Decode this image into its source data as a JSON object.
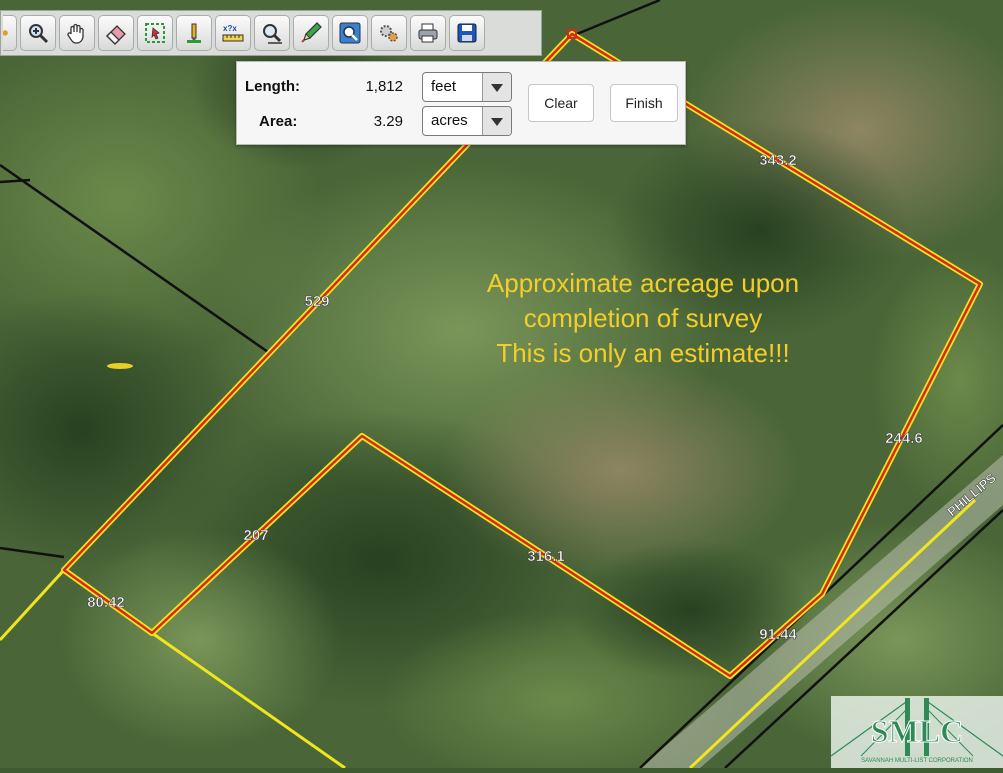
{
  "toolbar": {
    "tools": [
      {
        "icon": "partial-tool-icon"
      },
      {
        "icon": "zoom-in-icon"
      },
      {
        "icon": "pan-hand-icon"
      },
      {
        "icon": "eraser-icon"
      },
      {
        "icon": "select-region-icon"
      },
      {
        "icon": "marker-icon"
      },
      {
        "icon": "measure-icon"
      },
      {
        "icon": "zoom-extent-icon"
      },
      {
        "icon": "pencil-icon"
      },
      {
        "icon": "zoom-full-icon"
      },
      {
        "icon": "layers-gears-icon"
      },
      {
        "icon": "print-icon"
      },
      {
        "icon": "save-icon"
      }
    ]
  },
  "measure": {
    "length_label": "Length:",
    "length_value": "1,812",
    "length_unit": "feet",
    "area_label": "Area:",
    "area_value": "3.29",
    "area_unit": "acres",
    "clear_label": "Clear",
    "finish_label": "Finish"
  },
  "parcel": {
    "segment_labels": [
      "343.2",
      "529",
      "244.6",
      "207",
      "316.1",
      "80.42",
      "91.44"
    ],
    "road_label": "PHILLIPS",
    "annotation_lines": [
      "Approximate acreage upon",
      "completion of survey",
      "This is only an estimate!!!"
    ]
  },
  "logo": {
    "text": "SMLC",
    "subtext": "SAVANNAH MULTI-LIST CORPORATION"
  },
  "colors": {
    "parcel_red": "#d8281a",
    "boundary_yellow": "#f1e51c",
    "annotation_yellow": "#f3cd2a",
    "logo_green": "#2f8a55"
  }
}
